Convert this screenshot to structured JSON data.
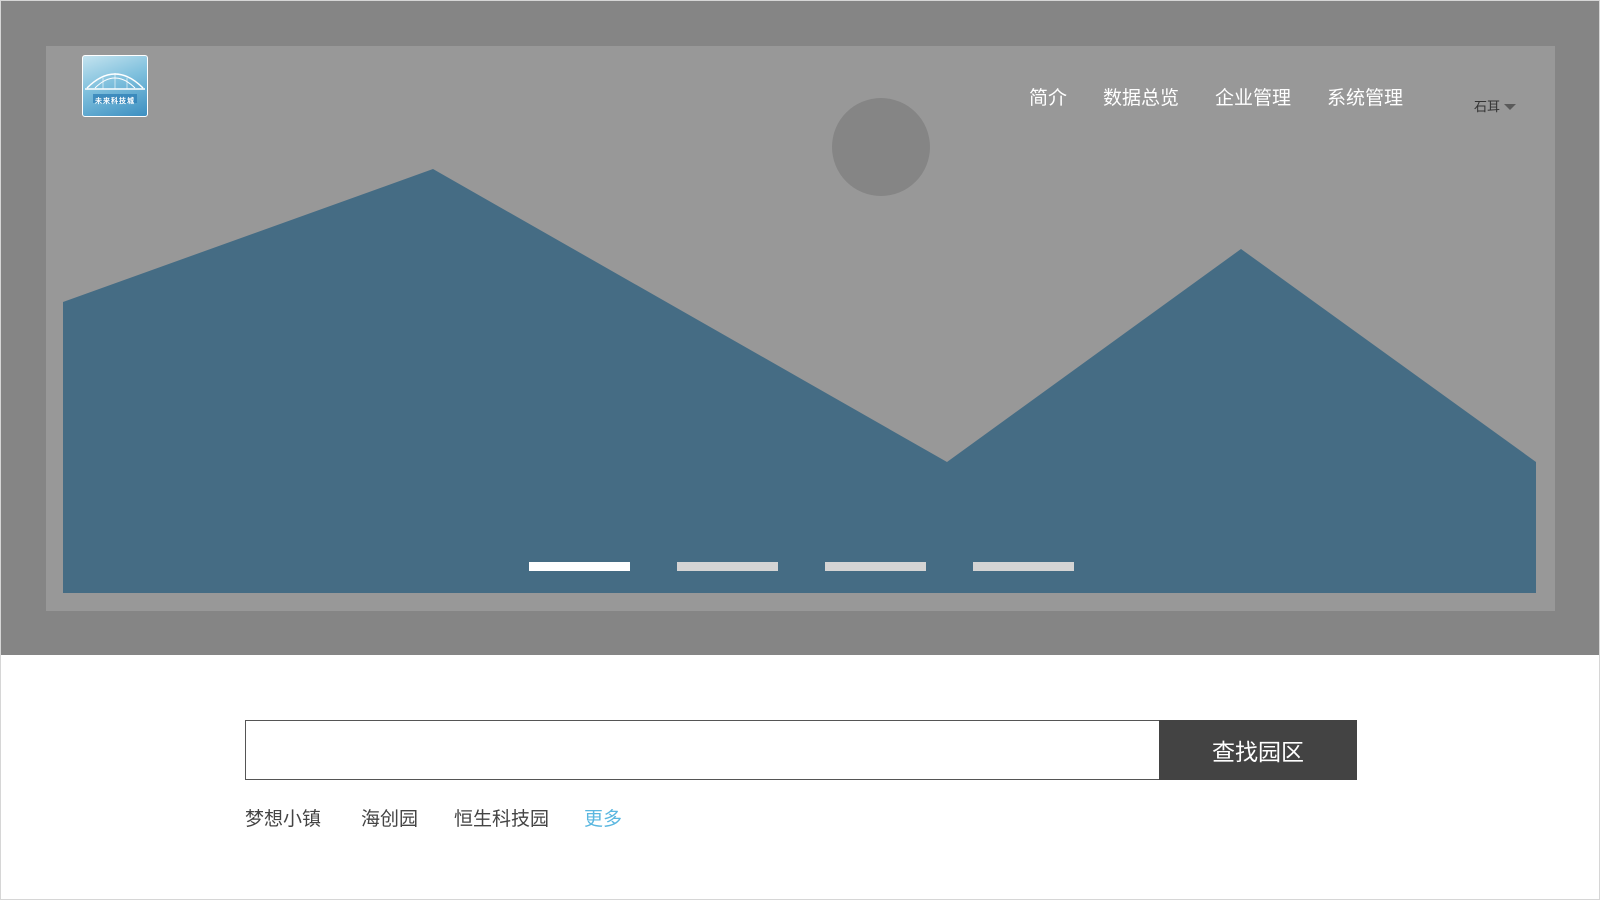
{
  "header": {
    "logo": {
      "icon": "bridge-logo-icon",
      "caption": "未来科技城"
    },
    "nav": [
      {
        "label": "简介"
      },
      {
        "label": "数据总览"
      },
      {
        "label": "企业管理"
      },
      {
        "label": "系统管理"
      }
    ],
    "user": {
      "name": "石耳",
      "icon": "caret-down-icon"
    }
  },
  "banner": {
    "image": "image-placeholder-icon",
    "colors": {
      "outer": "#858585",
      "inner": "#989898",
      "mountains": "#456c84",
      "sun": "#858585"
    },
    "slides": {
      "count": 4,
      "active_index": 0
    }
  },
  "search": {
    "value": "",
    "placeholder": "",
    "button_label": "查找园区"
  },
  "quick_links": [
    {
      "label": "梦想小镇"
    },
    {
      "label": "海创园"
    },
    {
      "label": "恒生科技园"
    },
    {
      "label": "更多",
      "color": "#5ab7e0"
    }
  ]
}
